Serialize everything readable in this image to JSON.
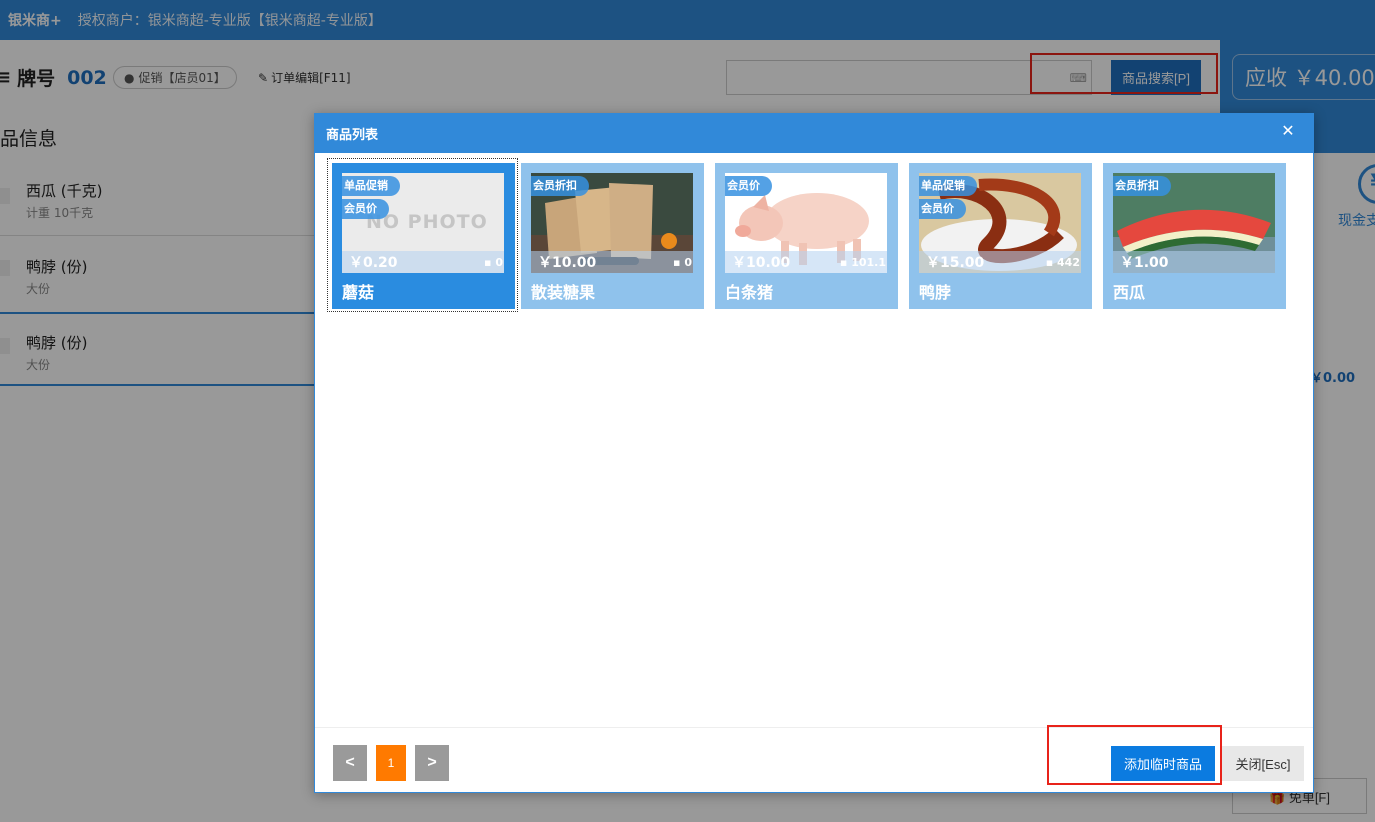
{
  "topbar": {
    "logo": "银米商+",
    "merchant": "授权商户：银米商超-专业版【银米商超-专业版】"
  },
  "order": {
    "pai_label": "牌号",
    "pai_number": "002",
    "promo_chip": "促销【店员01】",
    "edit_label": "订单编辑[F11]"
  },
  "search": {
    "value": "",
    "keyboard_icon": "keyboard-icon",
    "button_label": "商品搜索[P]"
  },
  "section_title": "品信息",
  "items": [
    {
      "name": "西瓜 (千克)",
      "sub": "计重  10千克"
    },
    {
      "name": "鸭脖 (份)",
      "sub": "大份"
    },
    {
      "name": "鸭脖 (份)",
      "sub": "大份"
    }
  ],
  "right": {
    "yingshou": "应收 ￥40.00",
    "cash_label": "现金支",
    "amount": "￥0.00",
    "free_btn": "免单[F]"
  },
  "modal": {
    "title": "商品列表",
    "close_icon": "close-icon",
    "products": [
      {
        "name": "蘑菇",
        "price": "￥0.20",
        "stock": "0",
        "tags": [
          "单品促销",
          "会员价"
        ],
        "image": "no-photo",
        "image_text": "NO PHOTO",
        "selected": true
      },
      {
        "name": "散装糖果",
        "price": "￥10.00",
        "stock": "0",
        "tags": [
          "会员折扣"
        ],
        "image": "candy-bags",
        "selected": false
      },
      {
        "name": "白条猪",
        "price": "￥10.00",
        "stock": "101.1",
        "tags": [
          "会员价"
        ],
        "image": "pig",
        "selected": false
      },
      {
        "name": "鸭脖",
        "price": "￥15.00",
        "stock": "442",
        "tags": [
          "单品促销",
          "会员价"
        ],
        "image": "duck-neck",
        "selected": false
      },
      {
        "name": "西瓜",
        "price": "￥1.00",
        "stock": "",
        "tags": [
          "会员折扣"
        ],
        "image": "watermelon",
        "selected": false
      }
    ],
    "pagination": {
      "prev": "<",
      "current": "1",
      "next": ">"
    },
    "add_button": "添加临时商品",
    "close_button": "关闭[Esc]"
  },
  "colors": {
    "primary": "#3189d9",
    "accent_orange": "#ff7a00",
    "highlight_red": "#e8231a"
  }
}
